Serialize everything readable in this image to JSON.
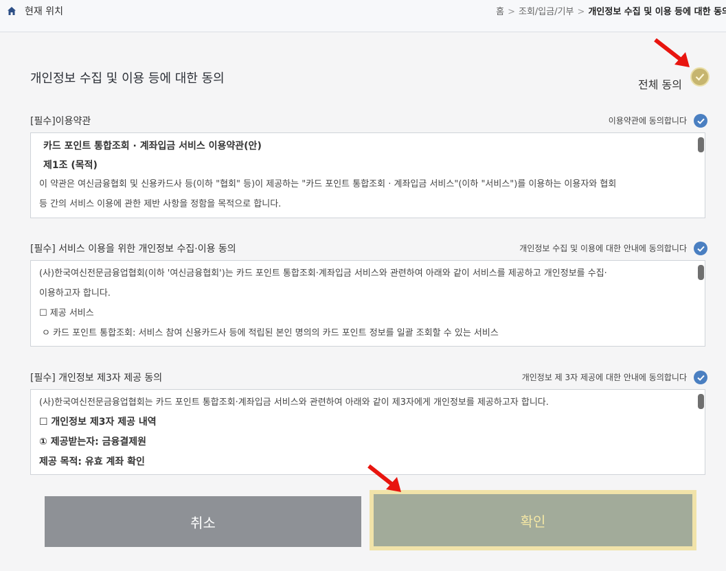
{
  "header": {
    "location_label": "현재 위치",
    "breadcrumb": [
      "홈",
      "조회/입금/기부",
      "개인정보 수집 및 이용 등에 대한 동의"
    ],
    "separator": ">"
  },
  "page": {
    "title": "개인정보 수집 및 이용 등에 대한 동의",
    "all_agree_label": "전체 동의"
  },
  "sections": [
    {
      "title": "[필수]이용약관",
      "agree_label": "이용약관에 동의합니다",
      "content": [
        "카드 포인트 통합조회 · 계좌입금 서비스 이용약관(안)",
        "제1조 (목적)",
        "이 약관은 여신금융협회 및 신용카드사 등(이하 \"협회\" 등)이 제공하는 \"카드 포인트 통합조회 · 계좌입금 서비스\"(이하 \"서비스\")를 이용하는 이용자와 협회",
        "등 간의 서비스 이용에 관한 제반 사항을 정함을 목적으로 합니다."
      ]
    },
    {
      "title": "[필수] 서비스 이용을 위한 개인정보 수집·이용 동의",
      "agree_label": "개인정보 수집 및 이용에 대한 안내에 동의합니다",
      "content": [
        "(사)한국여신전문금융업협회(이하 '여신금융협회')는 카드 포인트 통합조회·계좌입금 서비스와 관련하여 아래와 같이 서비스를 제공하고 개인정보를 수집·",
        "이용하고자 합니다.",
        "☐ 제공 서비스",
        "ㅇ 카드 포인트 통합조회: 서비스 참여 신용카드사 등에 적립된 본인 명의의 카드 포인트 정보를 일괄 조회할 수 있는 서비스"
      ]
    },
    {
      "title": "[필수] 개인정보 제3자 제공 동의",
      "agree_label": "개인정보 제 3자 제공에 대한 안내에 동의합니다",
      "content": [
        "(사)한국여신전문금융업협회는 카드 포인트 통합조회·계좌입금 서비스와 관련하여 아래와 같이 제3자에게 개인정보를 제공하고자 합니다.",
        "☐ 개인정보 제3자 제공 내역",
        "① 제공받는자: 금융결제원",
        "제공 목적: 유효 계좌 확인"
      ]
    }
  ],
  "buttons": {
    "cancel": "취소",
    "confirm": "확인"
  },
  "colors": {
    "all_agree_check": "#c6b56f",
    "section_check": "#4a7fc1",
    "cancel_bg": "#8e9196",
    "confirm_bg": "#a2ab9a",
    "confirm_border": "#f1e3a9",
    "arrow": "#e8150f"
  },
  "icons": {
    "home": "home-icon",
    "check": "check-icon",
    "arrow": "red-arrow-icon"
  }
}
